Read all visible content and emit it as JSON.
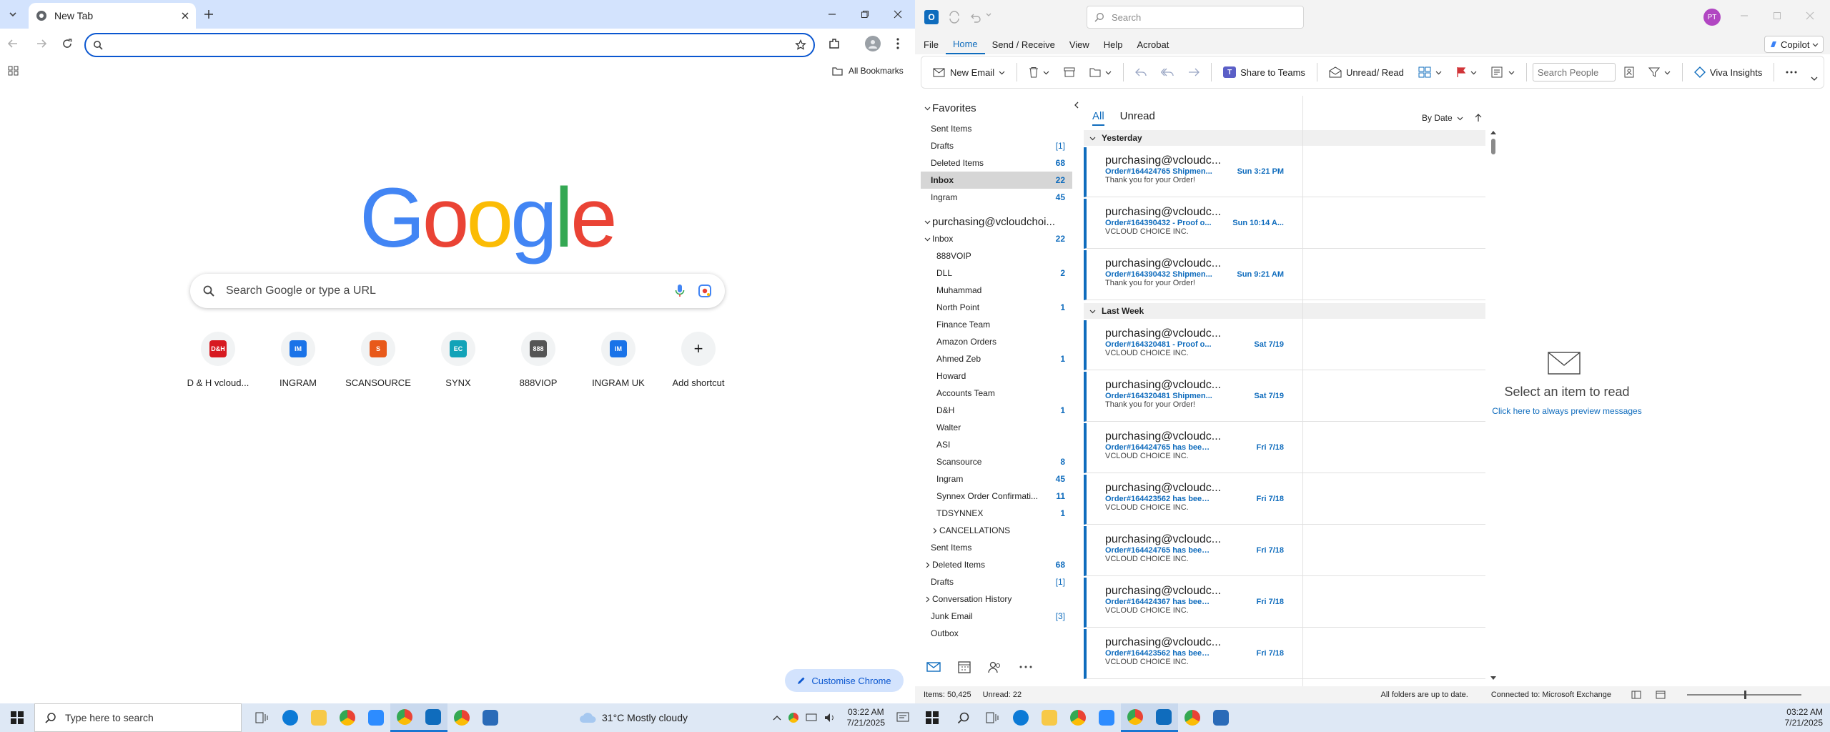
{
  "chrome": {
    "tab_title": "New Tab",
    "omnibox_value": "",
    "all_bookmarks": "All Bookmarks",
    "google_letters": [
      {
        "ch": "G",
        "color": "#4285f4"
      },
      {
        "ch": "o",
        "color": "#ea4335"
      },
      {
        "ch": "o",
        "color": "#fbbc05"
      },
      {
        "ch": "g",
        "color": "#4285f4"
      },
      {
        "ch": "l",
        "color": "#34a853"
      },
      {
        "ch": "e",
        "color": "#ea4335"
      }
    ],
    "search_placeholder": "Search Google or type a URL",
    "shortcuts": [
      {
        "label": "D & H vcloud...",
        "logo": "D&H",
        "color": "#d71920"
      },
      {
        "label": "INGRAM",
        "logo": "IM",
        "color": "#1a73e8"
      },
      {
        "label": "SCANSOURCE",
        "logo": "S",
        "color": "#e8591a"
      },
      {
        "label": "SYNX",
        "logo": "EC",
        "color": "#12a3b8"
      },
      {
        "label": "888VIOP",
        "logo": "888",
        "color": "#555555"
      },
      {
        "label": "INGRAM UK",
        "logo": "IM",
        "color": "#1a73e8"
      },
      {
        "label": "Add shortcut",
        "logo": "+",
        "color": "#1f1f1f"
      }
    ],
    "customise": "Customise Chrome"
  },
  "outlook": {
    "search_placeholder": "Search",
    "avatar": "PT",
    "menu": [
      "File",
      "Home",
      "Send / Receive",
      "View",
      "Help",
      "Acrobat"
    ],
    "active_menu": "Home",
    "copilot": "Copilot",
    "ribbon": {
      "new_email": "New Email",
      "share_to_teams": "Share to Teams",
      "unread_read": "Unread/ Read",
      "search_people": "Search People",
      "viva_insights": "Viva Insights"
    },
    "folders": [
      {
        "name": "Favorites",
        "count": "",
        "indent": 0,
        "head": true,
        "chev": "v"
      },
      {
        "name": "Sent Items",
        "count": "",
        "indent": 1
      },
      {
        "name": "Drafts",
        "count": "[1]",
        "indent": 1,
        "bracket": true
      },
      {
        "name": "Deleted Items",
        "count": "68",
        "indent": 1
      },
      {
        "name": "Inbox",
        "count": "22",
        "indent": 1,
        "selected": true,
        "bold": true
      },
      {
        "name": "Ingram",
        "count": "45",
        "indent": 1
      },
      {
        "name": "",
        "count": "",
        "indent": 0,
        "spacer": true
      },
      {
        "name": "purchasing@vcloudchoi...",
        "count": "",
        "indent": 0,
        "head": true,
        "chev": "v"
      },
      {
        "name": "Inbox",
        "count": "22",
        "indent": 0,
        "chev": "v"
      },
      {
        "name": "888VOIP",
        "count": "",
        "indent": 2
      },
      {
        "name": "DLL",
        "count": "2",
        "indent": 2
      },
      {
        "name": "Muhammad",
        "count": "",
        "indent": 2
      },
      {
        "name": "North Point",
        "count": "1",
        "indent": 2
      },
      {
        "name": "Finance Team",
        "count": "",
        "indent": 2
      },
      {
        "name": "Amazon Orders",
        "count": "",
        "indent": 2
      },
      {
        "name": "Ahmed Zeb",
        "count": "1",
        "indent": 2
      },
      {
        "name": "Howard",
        "count": "",
        "indent": 2
      },
      {
        "name": "Accounts Team",
        "count": "",
        "indent": 2
      },
      {
        "name": "D&H",
        "count": "1",
        "indent": 2
      },
      {
        "name": "Walter",
        "count": "",
        "indent": 2
      },
      {
        "name": "ASI",
        "count": "",
        "indent": 2
      },
      {
        "name": "Scansource",
        "count": "8",
        "indent": 2
      },
      {
        "name": "Ingram",
        "count": "45",
        "indent": 2
      },
      {
        "name": "Synnex Order Confirmati...",
        "count": "11",
        "indent": 2
      },
      {
        "name": "TDSYNNEX",
        "count": "1",
        "indent": 2
      },
      {
        "name": "CANCELLATIONS",
        "count": "",
        "indent": 1,
        "chev": ">"
      },
      {
        "name": "Sent Items",
        "count": "",
        "indent": 1
      },
      {
        "name": "Deleted Items",
        "count": "68",
        "indent": 0,
        "chev": ">"
      },
      {
        "name": "Drafts",
        "count": "[1]",
        "indent": 1,
        "bracket": true
      },
      {
        "name": "Conversation History",
        "count": "",
        "indent": 0,
        "chev": ">"
      },
      {
        "name": "Junk Email",
        "count": "[3]",
        "indent": 1,
        "bracket": true
      },
      {
        "name": "Outbox",
        "count": "",
        "indent": 1
      }
    ],
    "list_tabs": {
      "all": "All",
      "unread": "Unread",
      "sort": "By Date"
    },
    "groups": [
      {
        "label": "Yesterday",
        "messages": [
          {
            "from": "purchasing@vcloudc...",
            "subject": "Order#164424765 Shipmen...",
            "date": "Sun 3:21 PM",
            "preview": "Thank you for your Order!"
          },
          {
            "from": "purchasing@vcloudc...",
            "subject": "Order#164390432 - Proof o...",
            "date": "Sun 10:14 A...",
            "preview": "VCLOUD CHOICE INC."
          },
          {
            "from": "purchasing@vcloudc...",
            "subject": "Order#164390432 Shipmen...",
            "date": "Sun 9:21 AM",
            "preview": "Thank you for your Order!"
          }
        ]
      },
      {
        "label": "Last Week",
        "messages": [
          {
            "from": "purchasing@vcloudc...",
            "subject": "Order#164320481 - Proof o...",
            "date": "Sat 7/19",
            "preview": "VCLOUD CHOICE INC."
          },
          {
            "from": "purchasing@vcloudc...",
            "subject": "Order#164320481 Shipmen...",
            "date": "Sat 7/19",
            "preview": "Thank you for your Order!"
          },
          {
            "from": "purchasing@vcloudc...",
            "subject": "Order#164424765 has been...",
            "date": "Fri 7/18",
            "preview": "VCLOUD CHOICE INC."
          },
          {
            "from": "purchasing@vcloudc...",
            "subject": "Order#164423562 has been...",
            "date": "Fri 7/18",
            "preview": "VCLOUD CHOICE INC."
          },
          {
            "from": "purchasing@vcloudc...",
            "subject": "Order#164424765 has been...",
            "date": "Fri 7/18",
            "preview": "VCLOUD CHOICE INC."
          },
          {
            "from": "purchasing@vcloudc...",
            "subject": "Order#164424367 has been...",
            "date": "Fri 7/18",
            "preview": "VCLOUD CHOICE INC."
          },
          {
            "from": "purchasing@vcloudc...",
            "subject": "Order#164423562 has been...",
            "date": "Fri 7/18",
            "preview": "VCLOUD CHOICE INC."
          }
        ]
      }
    ],
    "reading": {
      "title": "Select an item to read",
      "link": "Click here to always preview messages"
    },
    "status": {
      "items": "Items: 50,425",
      "unread": "Unread: 22",
      "folders": "All folders are up to date.",
      "connected": "Connected to: Microsoft Exchange"
    }
  },
  "taskbar_left": {
    "search_placeholder": "Type here to search",
    "weather": "31°C  Mostly cloudy",
    "time": "03:22 AM",
    "date": "7/21/2025"
  },
  "taskbar_right": {
    "time": "03:22 AM",
    "date": "7/21/2025"
  }
}
